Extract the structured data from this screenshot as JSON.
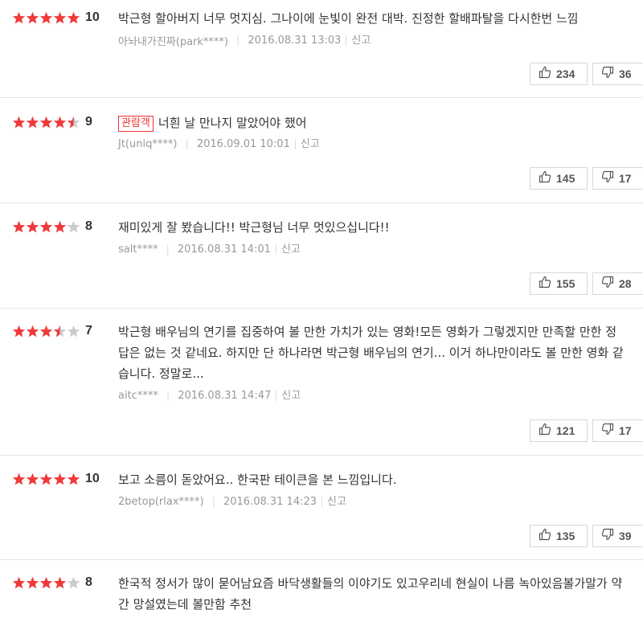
{
  "reviews": [
    {
      "rating": 5,
      "score": "10",
      "badge": "",
      "text": "박근형 할아버지 너무 멋지심. 그나이에 눈빛이 완전 대박. 진정한 할배파탈을 다시한번 느낌",
      "user": "아놔내가진짜(park****)",
      "date": "2016.08.31 13:03",
      "report": "신고",
      "likes": "234",
      "dislikes": "36"
    },
    {
      "rating": 4.5,
      "score": "9",
      "badge": "관람객",
      "text": "너흰 날 만나지 말았어야 했어",
      "user": "Jt(uniq****)",
      "date": "2016.09.01 10:01",
      "report": "신고",
      "likes": "145",
      "dislikes": "17"
    },
    {
      "rating": 4,
      "score": "8",
      "badge": "",
      "text": "재미있게 잘 봤습니다!! 박근형님 너무 멋있으십니다!!",
      "user": "salt****",
      "date": "2016.08.31 14:01",
      "report": "신고",
      "likes": "155",
      "dislikes": "28"
    },
    {
      "rating": 3.5,
      "score": "7",
      "badge": "",
      "text": "박근형 배우님의 연기를 집중하여 볼 만한 가치가 있는 영화!모든 영화가 그렇겠지만 만족할 만한 정답은 없는 것 같네요. 하지만 단 하나라면 박근형 배우님의 연기... 이거 하나만이라도 볼 만한 영화 같습니다. 정말로...",
      "user": "aitc****",
      "date": "2016.08.31 14:47",
      "report": "신고",
      "likes": "121",
      "dislikes": "17"
    },
    {
      "rating": 5,
      "score": "10",
      "badge": "",
      "text": "보고 소름이 돋았어요.. 한국판 테이큰을 본 느낌입니다.",
      "user": "2betop(rlax****)",
      "date": "2016.08.31 14:23",
      "report": "신고",
      "likes": "135",
      "dislikes": "39"
    },
    {
      "rating": 4,
      "score": "8",
      "badge": "",
      "text": "한국적 정서가 많이 묻어남요즘 바닥생활들의 이야기도 있고우리네 현실이 나름 녹아있음볼가말가 약간 망설였는데 볼만함 추천",
      "user": "",
      "date": "",
      "report": "",
      "likes": "",
      "dislikes": ""
    }
  ],
  "colors": {
    "star_on": "#f03a3a",
    "star_off": "#cccccc"
  },
  "icons": {
    "like": "thumbs-up-icon",
    "dislike": "thumbs-down-icon"
  }
}
